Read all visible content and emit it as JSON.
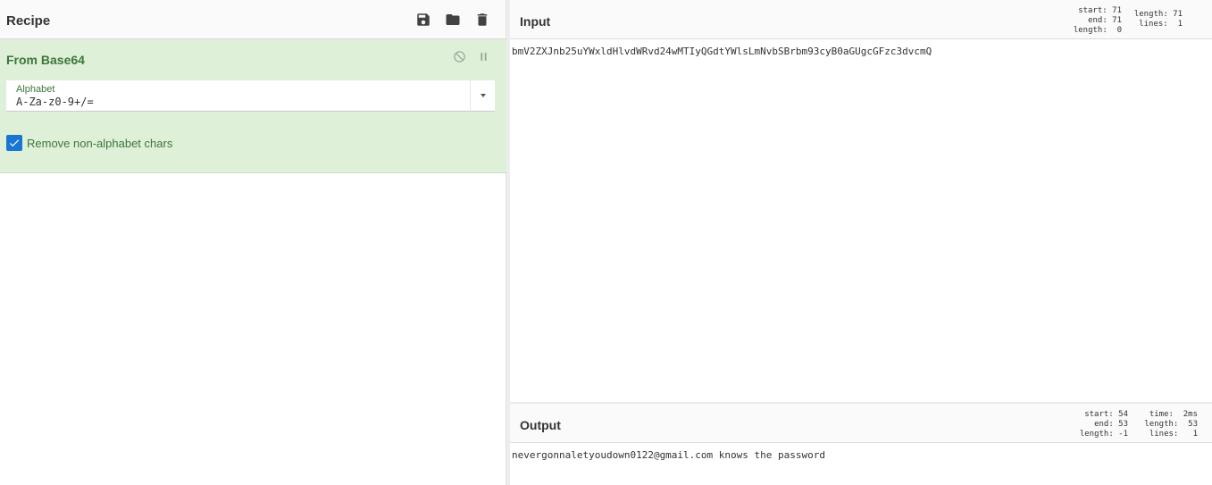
{
  "recipe": {
    "title": "Recipe",
    "actions": [
      {
        "name": "save-recipe-button",
        "icon": "save-icon"
      },
      {
        "name": "load-recipe-button",
        "icon": "folder-icon"
      },
      {
        "name": "clear-recipe-button",
        "icon": "trash-icon"
      }
    ],
    "operation": {
      "title": "From Base64",
      "disable_icon": "disable-icon",
      "pause_icon": "pause-icon",
      "alphabet_label": "Alphabet",
      "alphabet_value": "A-Za-z0-9+/=",
      "checkbox_label": "Remove non-alphabet chars",
      "checkbox_checked": true
    }
  },
  "input": {
    "title": "Input",
    "stats_left": [
      "start: 71",
      "end: 71",
      "length:  0"
    ],
    "stats_right": [
      "length: 71",
      "lines:  1"
    ],
    "text": "bmV2ZXJnb25uYWxldHlvdWRvd24wMTIyQGdtYWlsLmNvbSBrbm93cyB0aGUgcGFzc3dvcmQ"
  },
  "output": {
    "title": "Output",
    "stats_left": [
      "start: 54",
      "end: 53",
      "length: -1"
    ],
    "stats_right": [
      "time:  2ms",
      "length:  53",
      "lines:   1"
    ],
    "text": "nevergonnaletyoudown0122@gmail.com knows the password"
  },
  "colors": {
    "operation_bg": "#dff0d8",
    "operation_text": "#3c763d",
    "checkbox": "#1976d2"
  }
}
